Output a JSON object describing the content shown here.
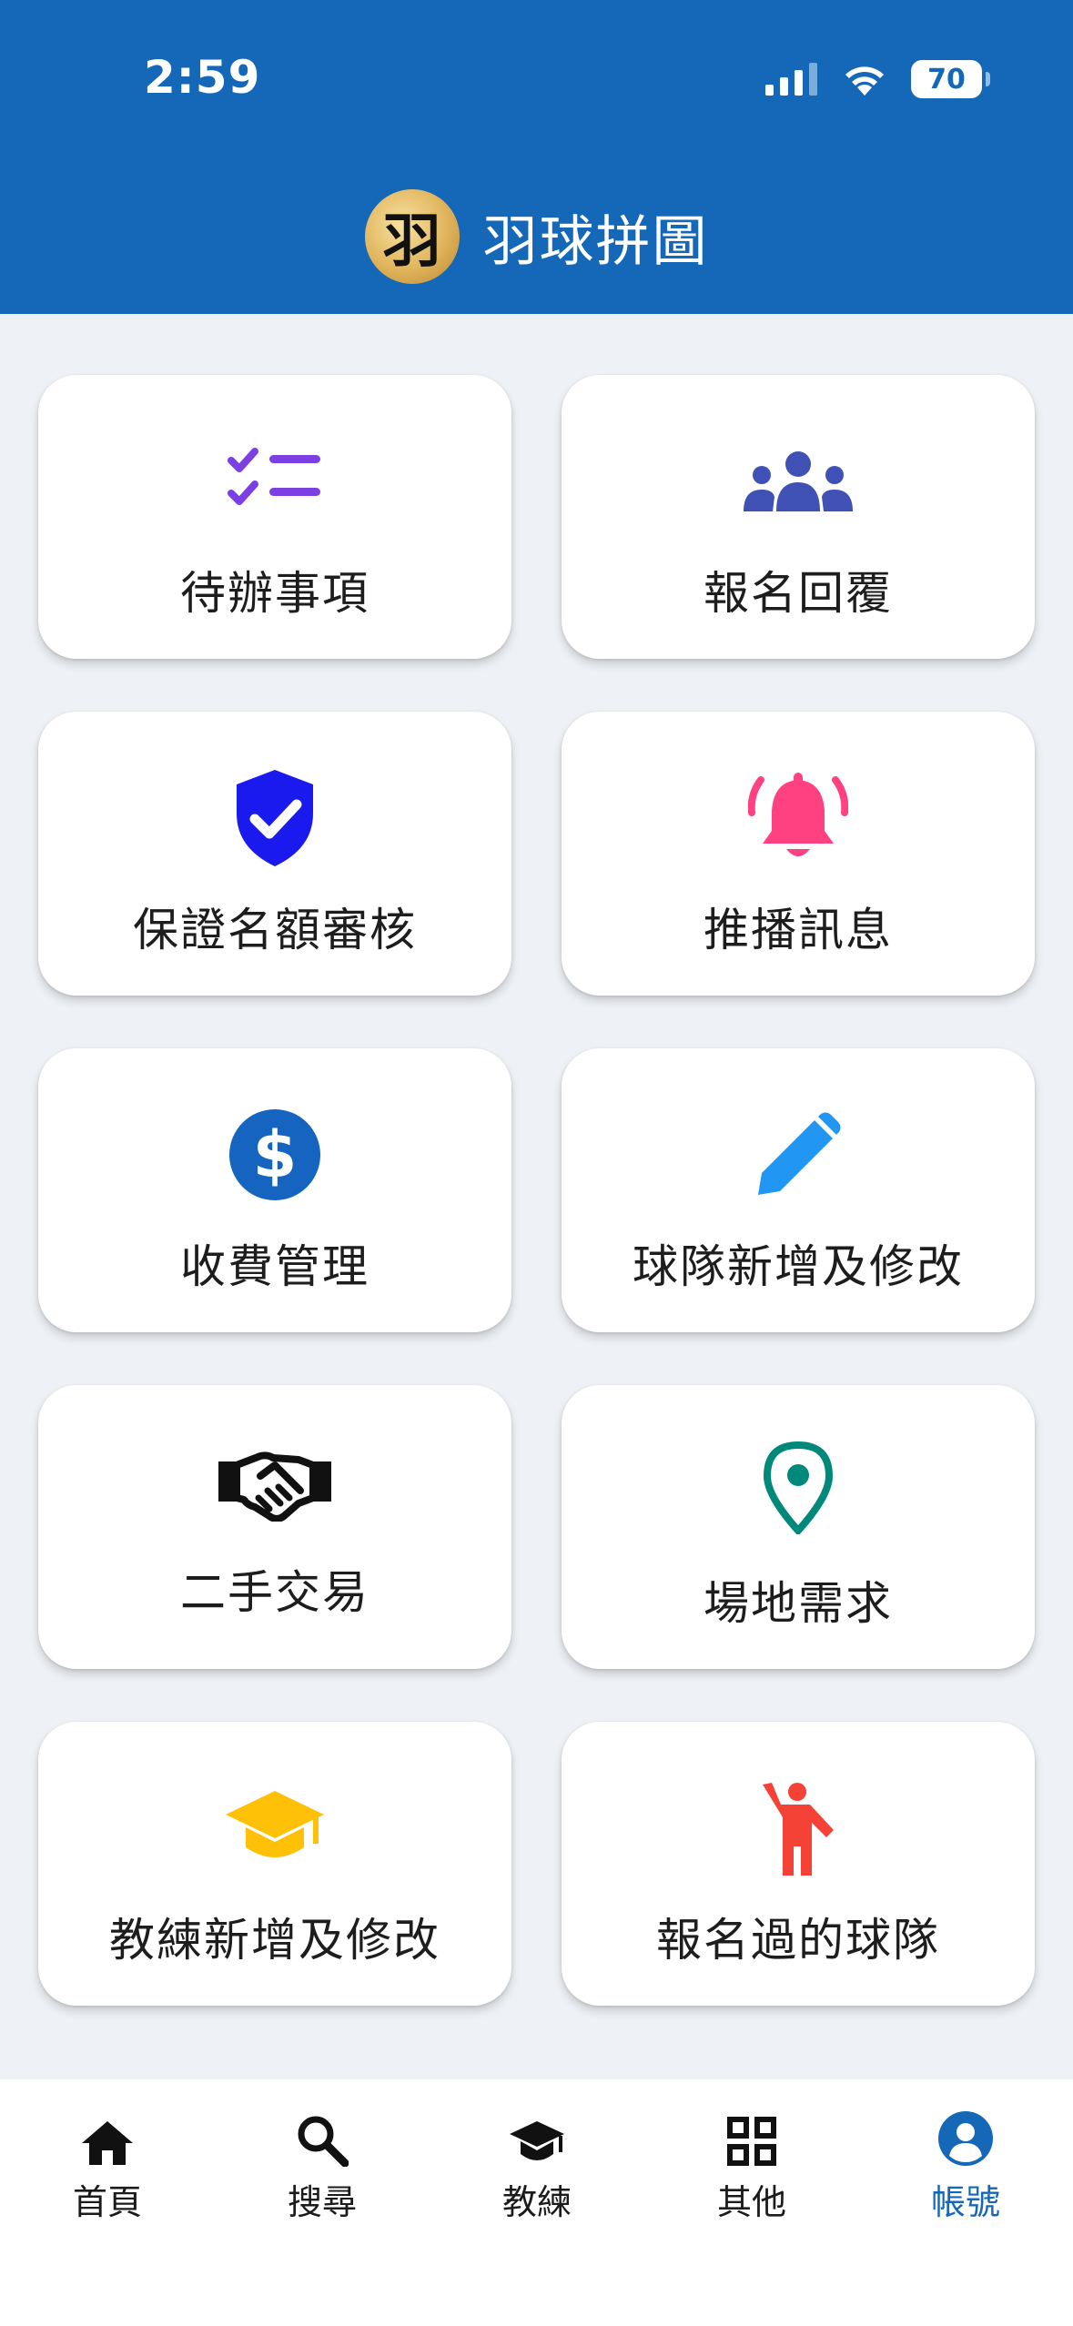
{
  "status_bar": {
    "time": "2:59",
    "battery": "70"
  },
  "header": {
    "logo_char": "羽",
    "title": "羽球拼圖"
  },
  "cards": [
    {
      "label": "待辦事項",
      "icon": "checklist-icon",
      "color": "#7b3fe4"
    },
    {
      "label": "報名回覆",
      "icon": "people-group-icon",
      "color": "#3f51b5"
    },
    {
      "label": "保證名額審核",
      "icon": "shield-check-icon",
      "color": "#1a1aef"
    },
    {
      "label": "推播訊息",
      "icon": "bell-ringing-icon",
      "color": "#ff4081"
    },
    {
      "label": "收費管理",
      "icon": "dollar-circle-icon",
      "color": "#1565c0"
    },
    {
      "label": "球隊新增及修改",
      "icon": "pencil-icon",
      "color": "#2196f3"
    },
    {
      "label": "二手交易",
      "icon": "handshake-icon",
      "color": "#111111"
    },
    {
      "label": "場地需求",
      "icon": "map-pin-icon",
      "color": "#00897b"
    },
    {
      "label": "教練新增及修改",
      "icon": "graduation-cap-icon",
      "color": "#ffc107"
    },
    {
      "label": "報名過的球隊",
      "icon": "person-waving-icon",
      "color": "#f44336"
    }
  ],
  "tabs": [
    {
      "label": "首頁",
      "icon": "home-icon"
    },
    {
      "label": "搜尋",
      "icon": "search-icon"
    },
    {
      "label": "教練",
      "icon": "graduation-cap-icon"
    },
    {
      "label": "其他",
      "icon": "grid-icon"
    },
    {
      "label": "帳號",
      "icon": "account-circle-icon",
      "active": true
    }
  ],
  "colors": {
    "primary": "#1568b8",
    "background": "#eef2f6"
  }
}
